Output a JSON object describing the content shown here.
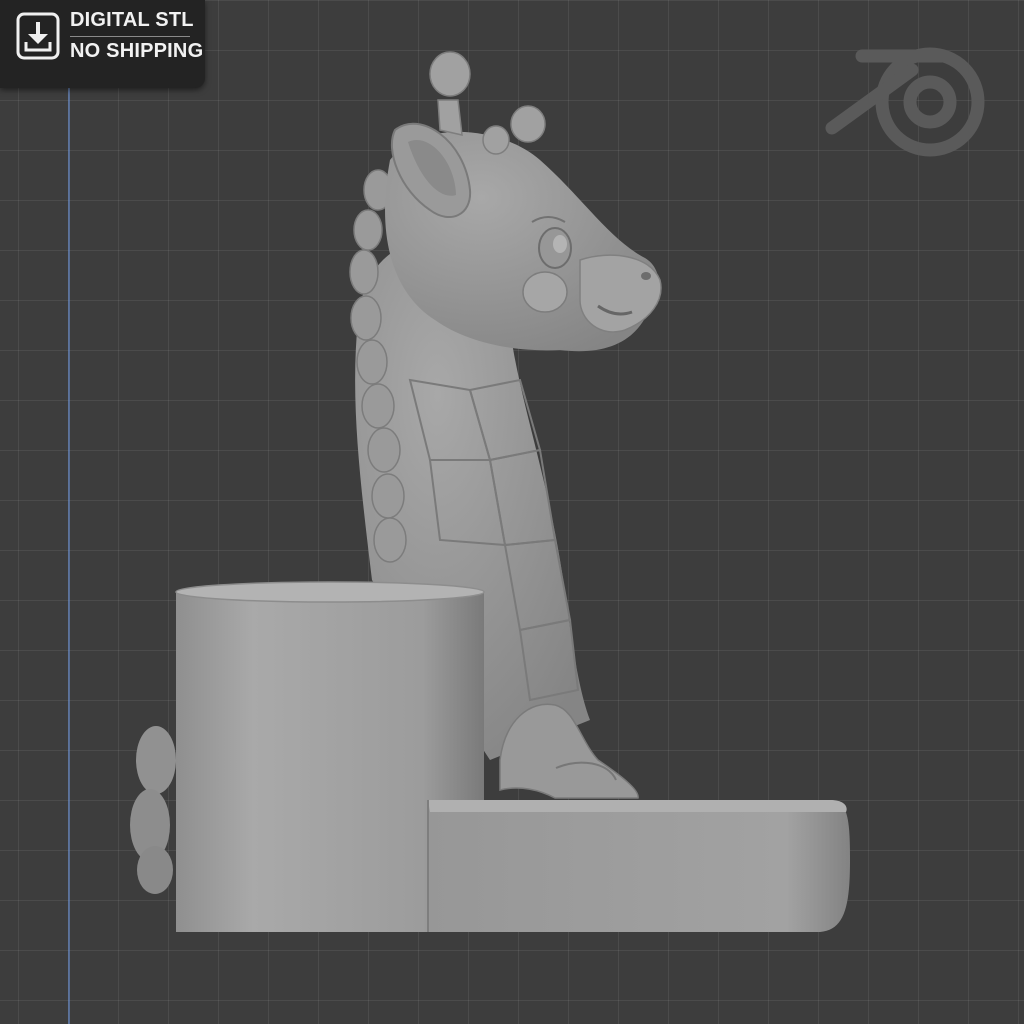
{
  "badge": {
    "line1": "DIGITAL STL",
    "line2": "NO SHIPPING",
    "icon": "download-icon"
  },
  "viewport": {
    "background_color": "#3d3d3d",
    "grid_line_color": "#4a4a4a",
    "axis_line_color": "#6e96dc",
    "logo_icon": "blender-logo-icon",
    "model": "giraffe-pen-holder-model"
  }
}
